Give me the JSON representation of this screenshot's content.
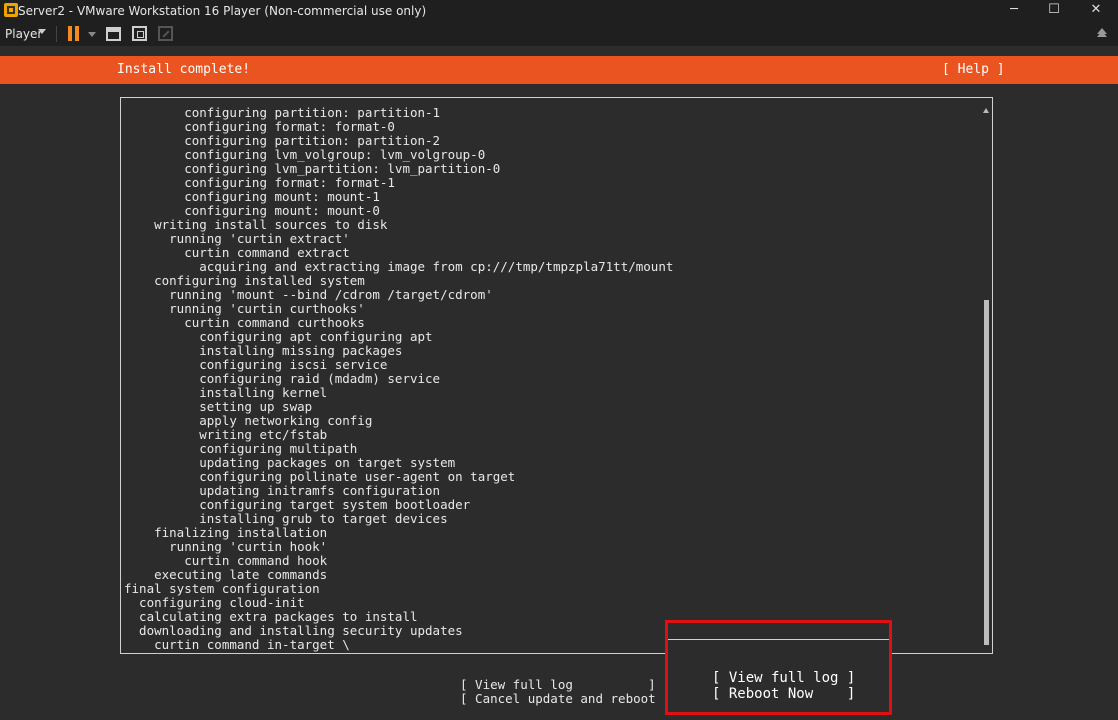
{
  "window": {
    "title": "Server2 - VMware Workstation 16 Player (Non-commercial use only)",
    "minimize": "─",
    "maximize": "☐",
    "close": "✕"
  },
  "toolbar": {
    "player_label": "Player"
  },
  "installer": {
    "header_title": "Install complete!",
    "help_label": "[ Help ]",
    "log_lines": [
      "        configuring partition: partition-1",
      "        configuring format: format-0",
      "        configuring partition: partition-2",
      "        configuring lvm_volgroup: lvm_volgroup-0",
      "        configuring lvm_partition: lvm_partition-0",
      "        configuring format: format-1",
      "        configuring mount: mount-1",
      "        configuring mount: mount-0",
      "    writing install sources to disk",
      "      running 'curtin extract'",
      "        curtin command extract",
      "          acquiring and extracting image from cp:///tmp/tmpzpla71tt/mount",
      "    configuring installed system",
      "      running 'mount --bind /cdrom /target/cdrom'",
      "      running 'curtin curthooks'",
      "        curtin command curthooks",
      "          configuring apt configuring apt",
      "          installing missing packages",
      "          configuring iscsi service",
      "          configuring raid (mdadm) service",
      "          installing kernel",
      "          setting up swap",
      "          apply networking config",
      "          writing etc/fstab",
      "          configuring multipath",
      "          updating packages on target system",
      "          configuring pollinate user-agent on target",
      "          updating initramfs configuration",
      "          configuring target system bootloader",
      "          installing grub to target devices",
      "    finalizing installation",
      "      running 'curtin hook'",
      "        curtin command hook",
      "    executing late commands",
      "final system configuration",
      "  configuring cloud-init",
      "  calculating extra packages to install",
      "  downloading and installing security updates",
      "    curtin command in-target \\"
    ],
    "view_full_log": "[ View full log          ]",
    "cancel_update_reboot": "[ Cancel update and reboot ]",
    "popup": {
      "view_full_log": "[ View full log ]",
      "reboot_now": "[ Reboot Now    ]"
    }
  },
  "colors": {
    "header_accent": "#e95420",
    "highlight_border": "#e01010"
  }
}
